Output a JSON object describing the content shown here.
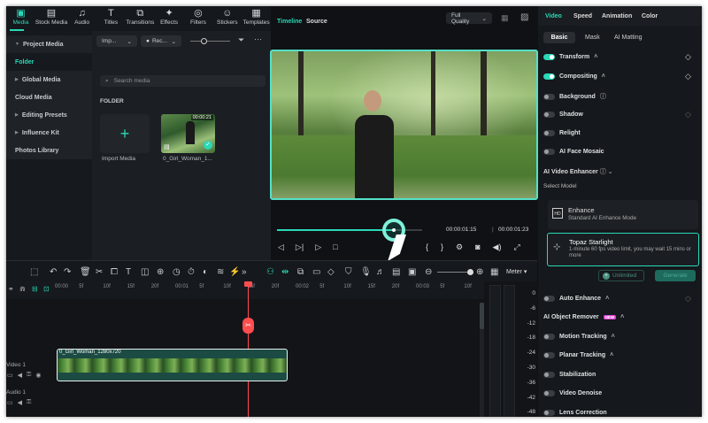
{
  "toolbar": {
    "items": [
      {
        "label": "Media",
        "icon": "media-icon"
      },
      {
        "label": "Stock Media",
        "icon": "stock-media-icon"
      },
      {
        "label": "Audio",
        "icon": "audio-icon"
      },
      {
        "label": "Titles",
        "icon": "titles-icon"
      },
      {
        "label": "Transitions",
        "icon": "transitions-icon"
      },
      {
        "label": "Effects",
        "icon": "effects-icon"
      },
      {
        "label": "Filters",
        "icon": "filters-icon"
      },
      {
        "label": "Stickers",
        "icon": "stickers-icon"
      },
      {
        "label": "Templates",
        "icon": "templates-icon"
      }
    ]
  },
  "sidebar": {
    "items": [
      "Project Media",
      "Folder",
      "Global Media",
      "Cloud Media",
      "Editing Presets",
      "Influence Kit",
      "Photos Library"
    ]
  },
  "media": {
    "import_dropdown": "Imp...",
    "rec_dropdown": "Rec...",
    "search_placeholder": "Search media",
    "folder_heading": "FOLDER",
    "import_label": "Import Media",
    "clip_name": "0_Girl_Woman_1...",
    "clip_duration": "00:00:21"
  },
  "viewer": {
    "tab_timeline": "Timeline",
    "tab_source": "Source",
    "quality": "Full Quality",
    "current_time": "00:00:01:15",
    "total_time": "00:00:01:23",
    "progress": 0.81
  },
  "timeline": {
    "meter_label": "Meter",
    "ruler_labels": [
      "00:00",
      "5f",
      "10f",
      "15f",
      "20f",
      "00:01",
      "5f",
      "10f",
      "15f",
      "20f",
      "00:02",
      "5f",
      "10f",
      "15f",
      "20f",
      "00:03",
      "5f",
      "10f"
    ],
    "video_track": "Video 1",
    "audio_track": "Audio 1",
    "clip_label": "0_Girl_Woman_1280x720",
    "meter_scale": [
      "0",
      "-6",
      "-12",
      "-18",
      "-24",
      "-30",
      "-36",
      "-42",
      "-48"
    ]
  },
  "right_panel": {
    "tabs": [
      "Video",
      "Speed",
      "Animation",
      "Color"
    ],
    "subtabs": [
      "Basic",
      "Mask",
      "AI Matting"
    ],
    "rows1": [
      {
        "label": "Transform",
        "on": true
      },
      {
        "label": "Compositing",
        "on": true
      },
      {
        "label": "Background",
        "on": false
      },
      {
        "label": "Shadow",
        "on": false
      },
      {
        "label": "Relight",
        "on": false
      },
      {
        "label": "AI Face Mosaic",
        "on": false
      }
    ],
    "enhancer_title": "AI Video Enhancer",
    "select_model": "Select Model",
    "enhance_title": "Enhance",
    "enhance_desc": "Standard AI Enhance Mode",
    "topaz_title": "Topaz Starlight",
    "topaz_desc": "1-minute 60 fps video limit, you may wait 15 mins or more",
    "unlimited": "Unlimited",
    "generate": "Generate",
    "rows2": [
      {
        "label": "Auto Enhance",
        "on": false
      },
      {
        "label": "AI Object Remover",
        "on": null
      },
      {
        "label": "Motion Tracking",
        "on": false
      },
      {
        "label": "Planar Tracking",
        "on": false
      },
      {
        "label": "Stabilization",
        "on": false
      },
      {
        "label": "Video Denoise",
        "on": false
      },
      {
        "label": "Lens Correction",
        "on": false
      }
    ]
  },
  "colors": {
    "accent": "#29d9b8",
    "playhead": "#ff4d4f"
  }
}
